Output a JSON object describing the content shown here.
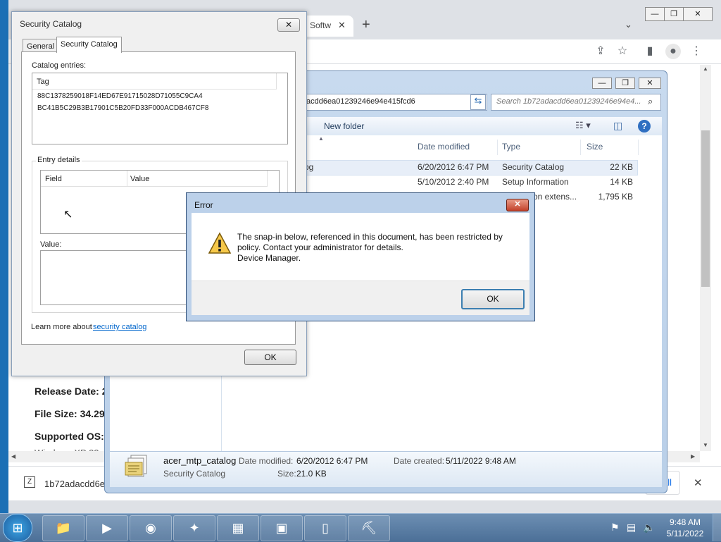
{
  "browser": {
    "tab_partial_label": "d Softw",
    "tab_close": "✕",
    "new_tab": "+",
    "page": {
      "release_date_label": "Release Date: 2(",
      "file_size_label": "File Size: 34.29N",
      "supported_os_label": "Supported OS: '",
      "cut_text": "Windows XP 32"
    },
    "download": {
      "file_label": "1b72adacdd6e",
      "show_all": "all",
      "close": "✕"
    }
  },
  "explorer": {
    "address_value": "acdd6ea01239246e94e415fcd6",
    "search_placeholder": "Search 1b72adacdd6ea01239246e94e4...",
    "new_folder": "New folder",
    "columns": [
      "Date modified",
      "Type",
      "Size"
    ],
    "files": [
      {
        "name": "og",
        "date": "6/20/2012 6:47 PM",
        "type": "Security Catalog",
        "size": "22 KB"
      },
      {
        "name": "",
        "date": "5/10/2012 2:40 PM",
        "type": "Setup Information",
        "size": "14 KB"
      },
      {
        "name": "",
        "date": "",
        "type": "on extens...",
        "size": "1,795 KB"
      }
    ],
    "details": {
      "name": "acer_mtp_catalog",
      "kind": "Security Catalog",
      "modified_label": "Date modified:",
      "modified_value": "6/20/2012 6:47 PM",
      "created_label": "Date created:",
      "created_value": "5/11/2022 9:48 AM",
      "size_label": "Size:",
      "size_value": "21.0 KB"
    }
  },
  "security_catalog": {
    "title": "Security Catalog",
    "tabs": [
      "General",
      "Security Catalog"
    ],
    "catalog_entries_label": "Catalog entries:",
    "tag_header": "Tag",
    "tags": [
      "88C1378259018F14ED67E91715028D71055C9CA4",
      "BC41B5C29B3B17901C5B20FD33F000ACDB467CF8"
    ],
    "entry_details_label": "Entry details",
    "field_header": "Field",
    "value_header": "Value",
    "value_label": "Value:",
    "learn_more_prefix": "Learn more about ",
    "learn_more_link": "security catalog",
    "ok": "OK"
  },
  "error_dialog": {
    "title": "Error",
    "close": "✕",
    "message_line1": "The snap-in below, referenced in this document, has been restricted by",
    "message_line2": "policy. Contact your administrator for details.",
    "message_line3": "Device Manager.",
    "ok": "OK"
  },
  "taskbar": {
    "time": "9:48 AM",
    "date": "5/11/2022"
  }
}
